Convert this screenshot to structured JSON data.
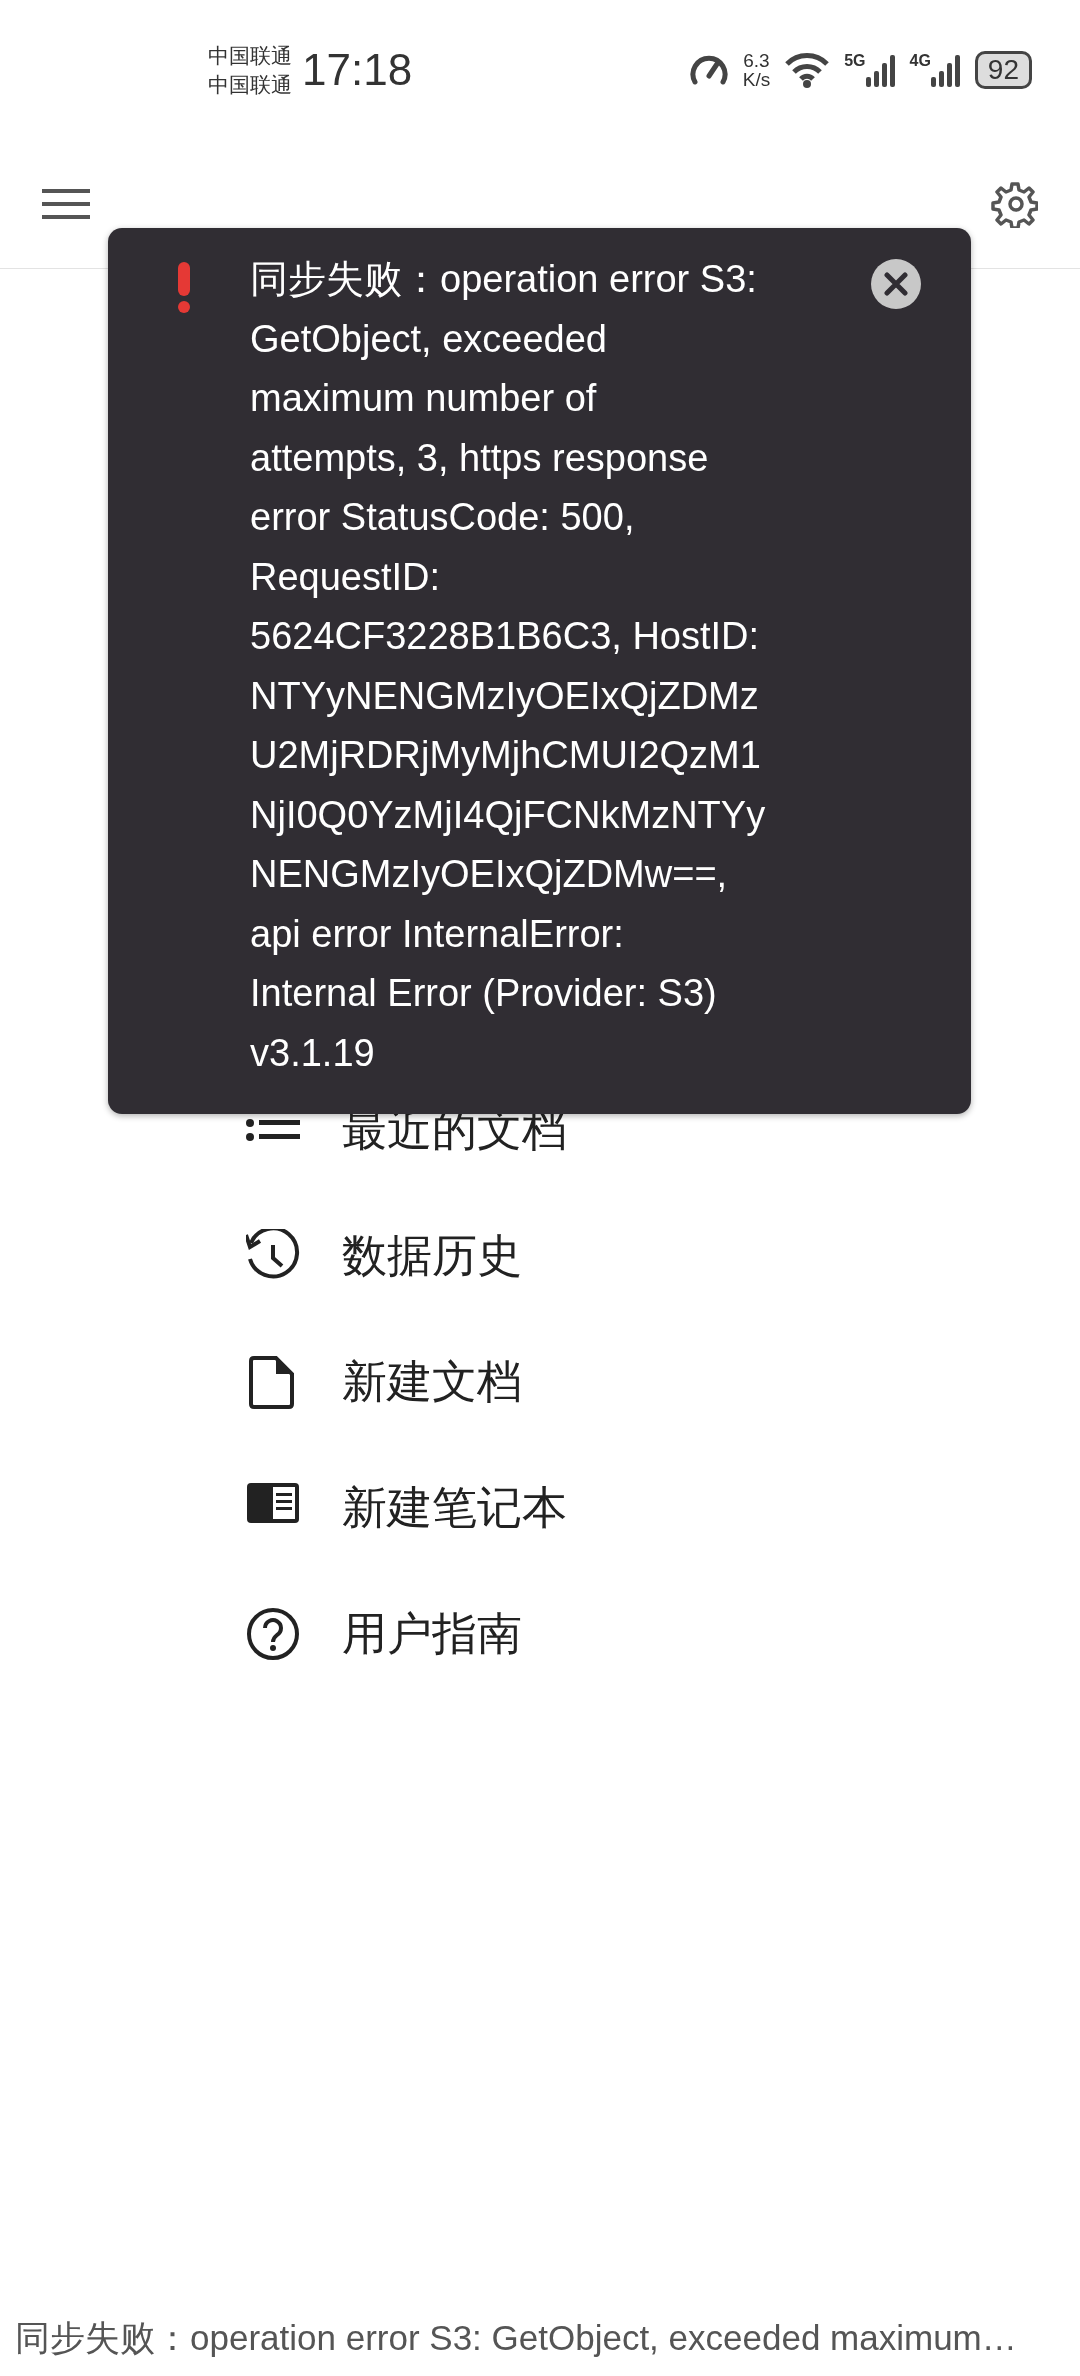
{
  "status_bar": {
    "carriers": [
      "中国联通",
      "中国联通"
    ],
    "time": "17:18",
    "speed_value": "6.3",
    "speed_unit": "K/s",
    "networks": [
      "5G",
      "4G"
    ],
    "battery": "92"
  },
  "toast": {
    "kind": "error",
    "lines": [
      "同步失败：operation error S3:",
      "GetObject, exceeded",
      "maximum number of",
      "attempts, 3, https response",
      "error StatusCode: 500,",
      "RequestID:",
      "5624CF3228B1B6C3, HostID:",
      "NTYyNENGMzIyOEIxQjZDMz",
      "U2MjRDRjMyMjhCMUI2QzM1",
      "NjI0Q0YzMjI4QjFCNkMzNTYy",
      "NENGMzIyOEIxQjZDMw==,",
      "api error InternalError:",
      "Internal Error (Provider: S3)",
      "v3.1.19"
    ]
  },
  "menu": [
    {
      "kind": "list",
      "label": "最近的文档"
    },
    {
      "kind": "history",
      "label": "数据历史"
    },
    {
      "kind": "document",
      "label": "新建文档"
    },
    {
      "kind": "notebook",
      "label": "新建笔记本"
    },
    {
      "kind": "help",
      "label": "用户指南"
    }
  ],
  "footer_status": "同步失败：operation error S3: GetObject, exceeded maximum…"
}
